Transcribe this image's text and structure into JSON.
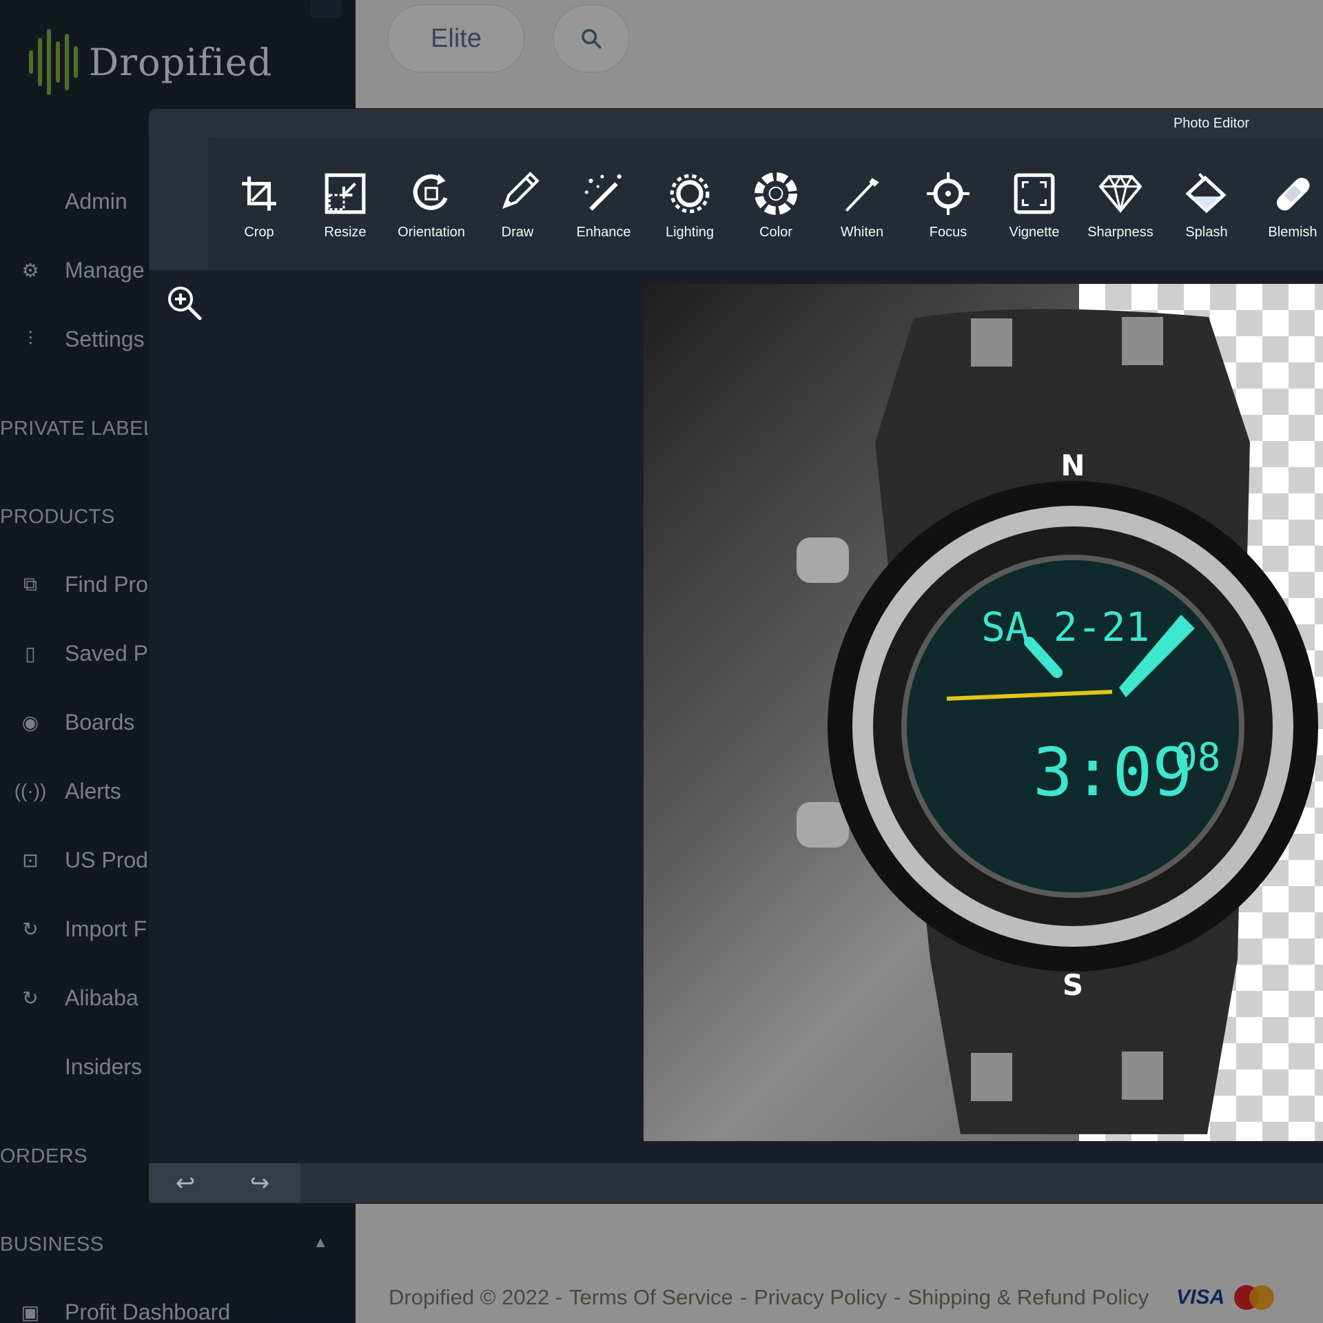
{
  "brand": {
    "name": "Dropified",
    "accent": "#7cb342"
  },
  "topbar": {
    "plan_label": "Elite",
    "search_icon": "search-icon"
  },
  "sidebar": {
    "items": [
      {
        "label": "Admin",
        "icon": ""
      },
      {
        "label": "Manage",
        "icon": "gear-icon"
      },
      {
        "label": "Settings",
        "icon": "sliders-icon"
      },
      {
        "label": "Find Pro",
        "icon": "find-products-icon"
      },
      {
        "label": "Saved P",
        "icon": "bookmark-icon"
      },
      {
        "label": "Boards",
        "icon": "boards-icon"
      },
      {
        "label": "Alerts",
        "icon": "alerts-icon"
      },
      {
        "label": "US Prod",
        "icon": "briefcase-icon"
      },
      {
        "label": "Import F",
        "icon": "import-icon"
      },
      {
        "label": "Alibaba",
        "icon": "import-icon"
      },
      {
        "label": "Insiders",
        "icon": ""
      },
      {
        "label": "Profit Dashboard",
        "icon": "chart-icon"
      }
    ],
    "sections": [
      "PRIVATE LABEL",
      "PRODUCTS",
      "ORDERS",
      "BUSINESS"
    ]
  },
  "editor": {
    "title": "Photo Editor",
    "tools": [
      {
        "label": "Crop",
        "icon": "crop-icon"
      },
      {
        "label": "Resize",
        "icon": "resize-icon"
      },
      {
        "label": "Orientation",
        "icon": "orientation-icon"
      },
      {
        "label": "Draw",
        "icon": "pencil-icon"
      },
      {
        "label": "Enhance",
        "icon": "magic-wand-icon"
      },
      {
        "label": "Lighting",
        "icon": "sun-icon"
      },
      {
        "label": "Color",
        "icon": "color-wheel-icon"
      },
      {
        "label": "Whiten",
        "icon": "whiten-brush-icon"
      },
      {
        "label": "Focus",
        "icon": "focus-icon"
      },
      {
        "label": "Vignette",
        "icon": "vignette-icon"
      },
      {
        "label": "Sharpness",
        "icon": "diamond-icon"
      },
      {
        "label": "Splash",
        "icon": "splash-bucket-icon"
      },
      {
        "label": "Blemish",
        "icon": "bandage-icon"
      }
    ],
    "undo_icon": "undo-icon",
    "redo_icon": "redo-icon",
    "zoom_icon": "zoom-in-icon"
  },
  "footer": {
    "copyright": "Dropified © 2022 -",
    "links": [
      "Terms Of Service",
      "Privacy Policy",
      "Shipping & Refund Policy"
    ],
    "separator": "-",
    "visa": "VISA"
  }
}
